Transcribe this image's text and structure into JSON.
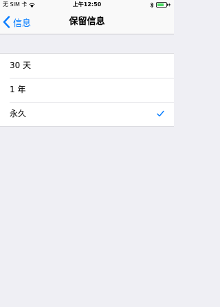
{
  "status_bar": {
    "carrier": "无 SIM 卡",
    "time": "上午12:50"
  },
  "nav": {
    "back_label": "信息",
    "title": "保留信息"
  },
  "options": [
    {
      "label": "30 天",
      "selected": false
    },
    {
      "label": "1 年",
      "selected": false
    },
    {
      "label": "永久",
      "selected": true
    }
  ],
  "colors": {
    "accent": "#007aff",
    "background": "#efeff4",
    "bar": "#f9f9f9"
  },
  "icons": {
    "back": "chevron-left-icon",
    "selected": "checkmark-icon"
  }
}
